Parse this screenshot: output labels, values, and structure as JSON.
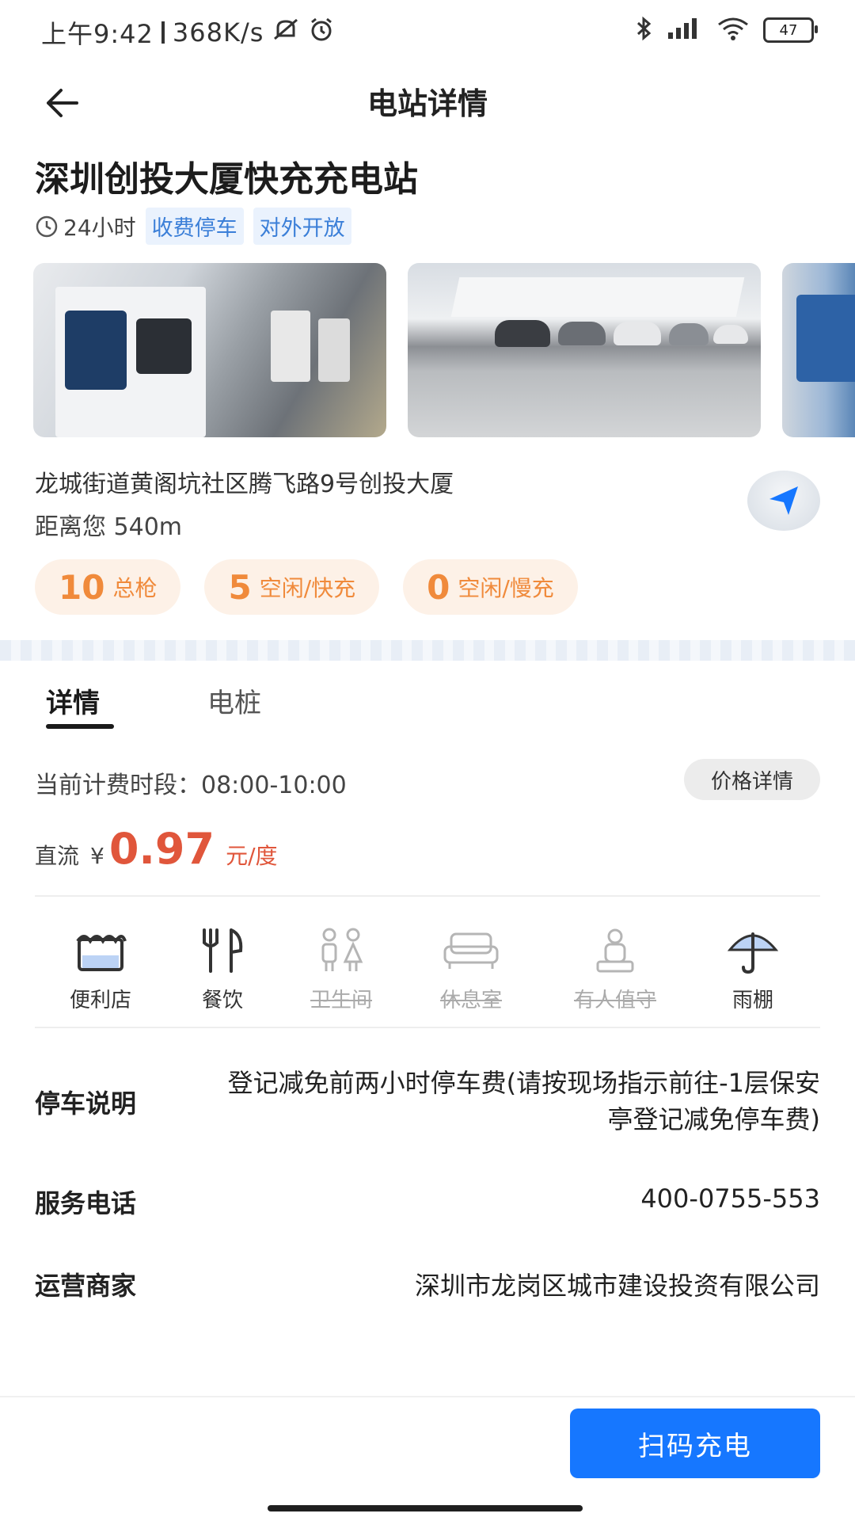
{
  "status_bar": {
    "time": "上午9:42",
    "speed": "368K/s",
    "battery": "47"
  },
  "header": {
    "title": "电站详情"
  },
  "station": {
    "name": "深圳创投大厦快充充电站",
    "hours": "24小时",
    "tags": [
      "收费停车",
      "对外开放"
    ],
    "address": "龙城街道黄阁坑社区腾飞路9号创投大厦",
    "distance": "距离您 540m"
  },
  "counts": [
    {
      "num": "10",
      "label": "总枪"
    },
    {
      "num": "5",
      "label": "空闲/快充"
    },
    {
      "num": "0",
      "label": "空闲/慢充"
    }
  ],
  "tabs": [
    {
      "label": "详情"
    },
    {
      "label": "电桩"
    }
  ],
  "pricing": {
    "period": "当前计费时段：08:00-10:00",
    "detail_button": "价格详情",
    "type": "直流",
    "currency": "¥",
    "value": "0.97",
    "unit": "元/度"
  },
  "amenities": [
    {
      "label": "便利店",
      "icon": "store-icon",
      "available": true
    },
    {
      "label": "餐饮",
      "icon": "dining-icon",
      "available": true
    },
    {
      "label": "卫生间",
      "icon": "restroom-icon",
      "available": false
    },
    {
      "label": "休息室",
      "icon": "sofa-icon",
      "available": false
    },
    {
      "label": "有人值守",
      "icon": "attendant-icon",
      "available": false
    },
    {
      "label": "雨棚",
      "icon": "umbrella-icon",
      "available": true
    }
  ],
  "info": {
    "parking": {
      "label": "停车说明",
      "value": "登记减免前两小时停车费(请按现场指示前往-1层保安亭登记减免停车费)"
    },
    "phone": {
      "label": "服务电话",
      "value": "400-0755-553"
    },
    "operator": {
      "label": "运营商家",
      "value": "深圳市龙岗区城市建设投资有限公司"
    }
  },
  "actions": {
    "scan_charge": "扫码充电"
  },
  "colors": {
    "accent": "#1677ff",
    "price": "#e0563b",
    "count": "#f08a3b",
    "tag_text": "#3b7fd8"
  }
}
